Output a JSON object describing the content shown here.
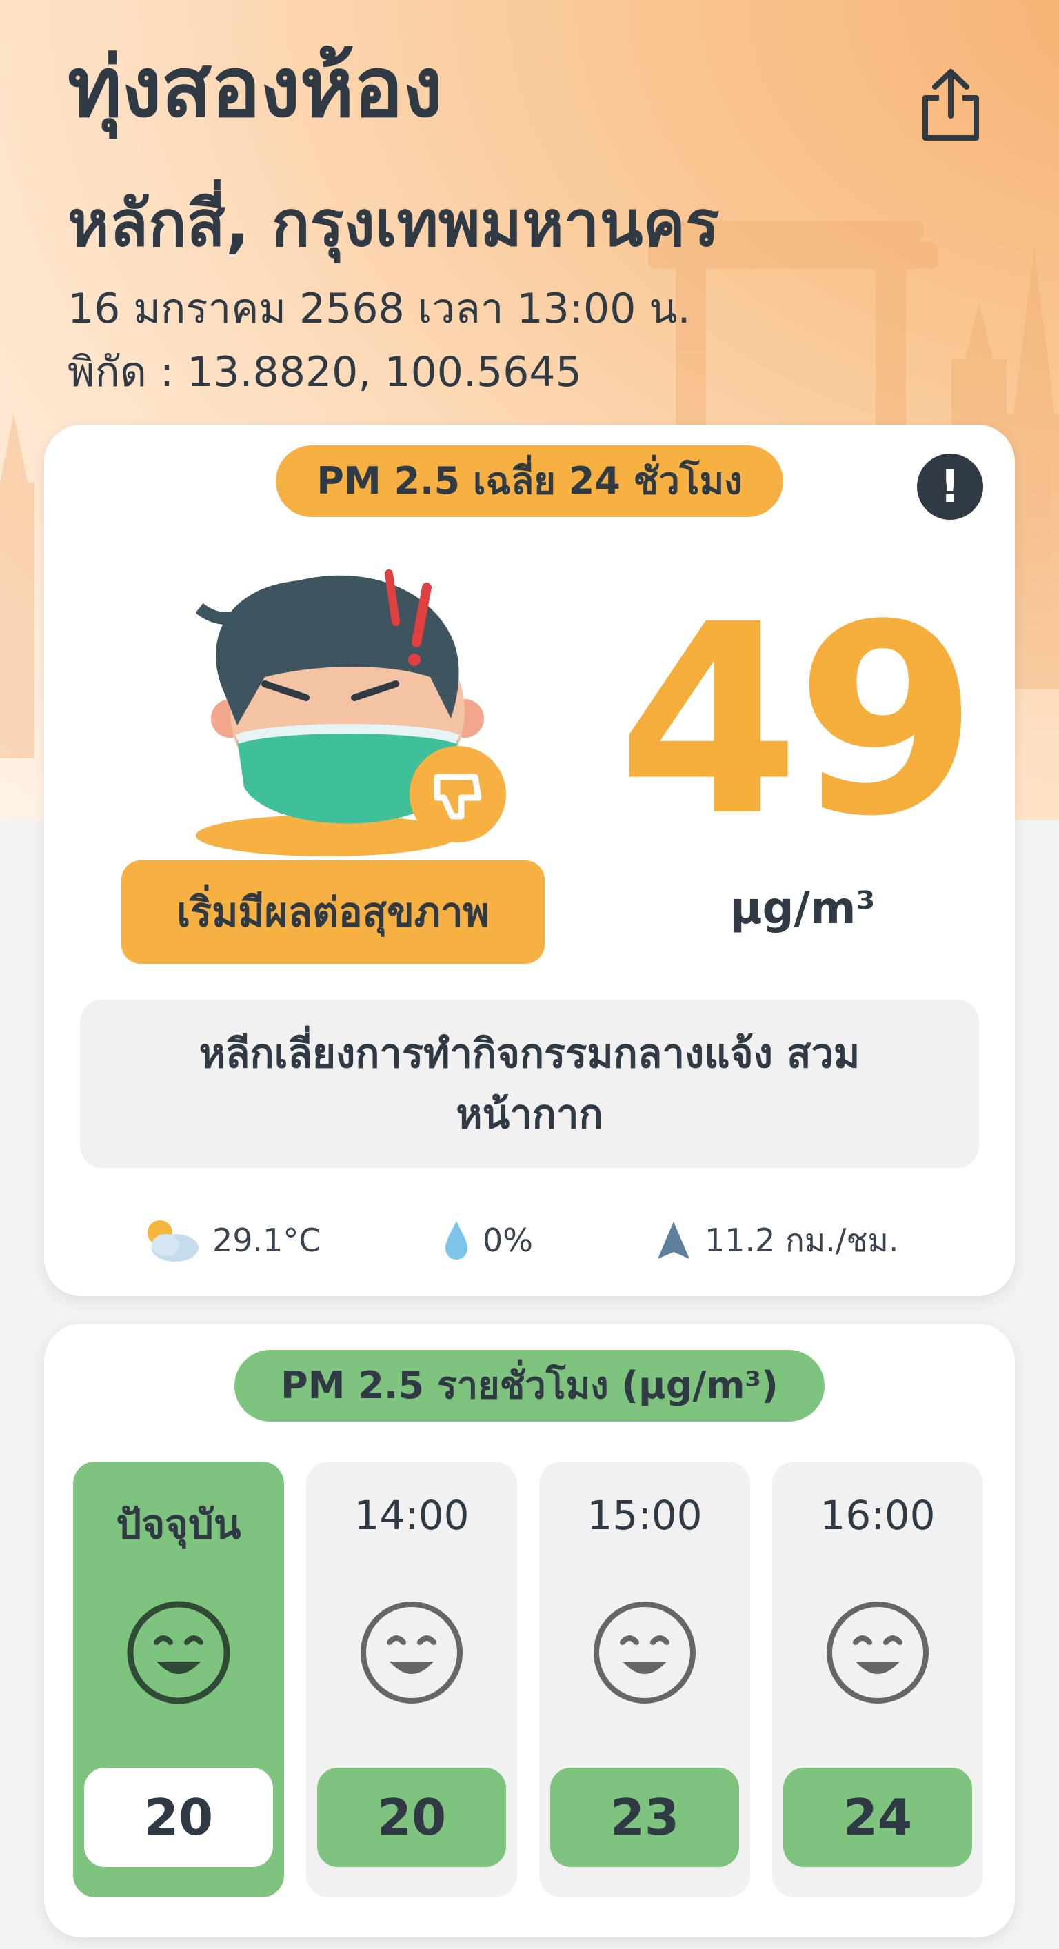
{
  "header": {
    "title": "ทุ่งสองห้อง",
    "subtitle": "หลักสี่, กรุงเทพมหานคร",
    "datetime": "16 มกราคม 2568  เวลา 13:00 น.",
    "coordinates": "พิกัด : 13.8820, 100.5645",
    "share_icon": "share-icon"
  },
  "aqi_card": {
    "label": "PM 2.5 เฉลี่ย 24 ชั่วโมง",
    "alert_symbol": "!",
    "value": "49",
    "unit": "µg/m³",
    "status": "เริ่มมีผลต่อสุขภาพ",
    "advice": "หลีกเลี่ยงการทำกิจกรรมกลางแจ้ง สวมหน้ากาก",
    "status_color": "#f7b142",
    "value_color": "#f5ae3c"
  },
  "weather": {
    "temperature": "29.1°C",
    "rain": "0%",
    "wind": "11.2 กม./ชม.",
    "temperature_icon": "partly-cloudy-icon",
    "rain_icon": "water-drop-icon",
    "wind_icon": "wind-direction-icon"
  },
  "hourly": {
    "label": "PM 2.5 รายชั่วโมง  (µg/m³)",
    "accent_color": "#7fc47e",
    "items": [
      {
        "time": "ปัจจุบัน",
        "value": "20"
      },
      {
        "time": "14:00",
        "value": "20"
      },
      {
        "time": "15:00",
        "value": "23"
      },
      {
        "time": "16:00",
        "value": "24"
      }
    ]
  }
}
